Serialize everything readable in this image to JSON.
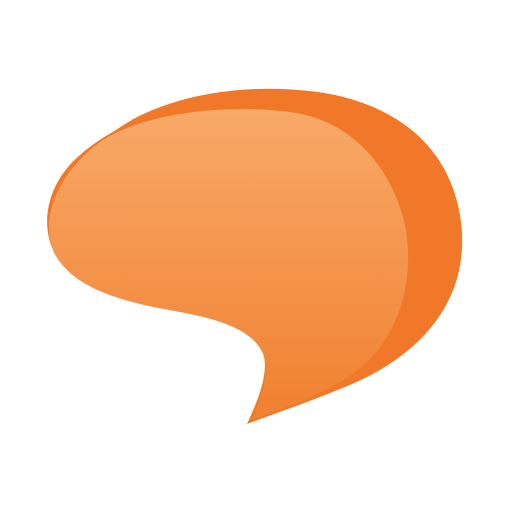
{
  "icon": {
    "name": "speech-bubble-icon",
    "colors": {
      "outer": "#f07828",
      "inner_top": "#f8a968",
      "inner_bottom": "#f0802f",
      "background": "#ffffff"
    }
  }
}
